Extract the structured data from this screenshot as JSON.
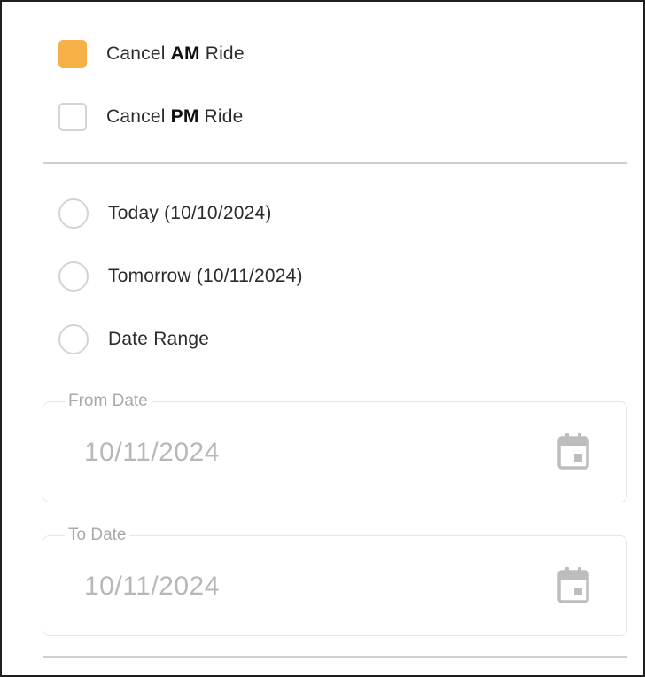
{
  "ride_options": [
    {
      "prefix": "Cancel ",
      "bold": "AM",
      "suffix": " Ride",
      "checked": true
    },
    {
      "prefix": "Cancel ",
      "bold": "PM",
      "suffix": " Ride",
      "checked": false
    }
  ],
  "date_options": [
    {
      "label": "Today (10/10/2024)",
      "selected": false
    },
    {
      "label": "Tomorrow (10/11/2024)",
      "selected": false
    },
    {
      "label": "Date Range",
      "selected": false
    }
  ],
  "from_date": {
    "label": "From Date",
    "value": "10/11/2024",
    "icon": "calendar-icon"
  },
  "to_date": {
    "label": "To Date",
    "value": "10/11/2024",
    "icon": "calendar-icon"
  },
  "colors": {
    "accent": "#f7b047",
    "disabled_text": "#b8b8b8"
  }
}
